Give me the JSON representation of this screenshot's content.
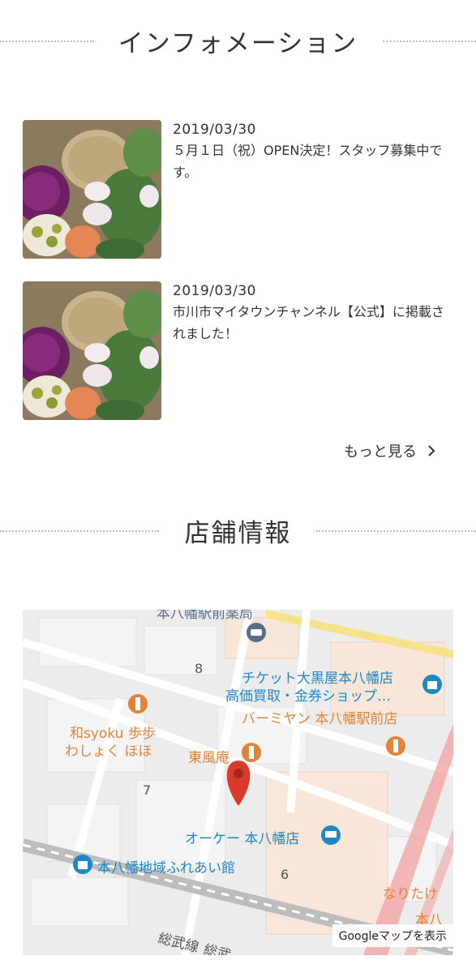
{
  "info": {
    "heading": "インフォメーション",
    "items": [
      {
        "date": "2019/03/30",
        "title": "５月１日（祝）OPEN決定！スタッフ募集中です。",
        "thumb_icon": "food-plate-photo"
      },
      {
        "date": "2019/03/30",
        "title": "市川市マイタウンチャンネル【公式】に掲載されました！",
        "thumb_icon": "food-plate-photo"
      }
    ],
    "more_label": "もっと見る"
  },
  "store": {
    "heading": "店舗情報"
  },
  "map": {
    "labels": {
      "pharmacy": "本八幡駅前薬局",
      "ticket1": "チケット大黒屋本八幡店",
      "ticket2": "高価買取・金券ショップ…",
      "bamiyan": "バーミヤン 本八幡駅前店",
      "washoku1": "和syoku 歩歩",
      "washoku2": "わしょく ほほ",
      "toufuan": "東風庵",
      "ok_store": "オーケー 本八幡店",
      "fureai": "本八幡地域ふれあい館",
      "naritake": "なりたけ",
      "motoyawata": "本八",
      "sobu1": "総武線",
      "sobu2": "総武",
      "block8": "8",
      "block7": "7",
      "block6": "6"
    },
    "button_label": "Googleマップを表示",
    "colors": {
      "poi_orange": "#e2833a",
      "poi_blue": "#1e88c7",
      "pin_red": "#d93a2c",
      "rail_pink": "#f2a6a6"
    }
  }
}
